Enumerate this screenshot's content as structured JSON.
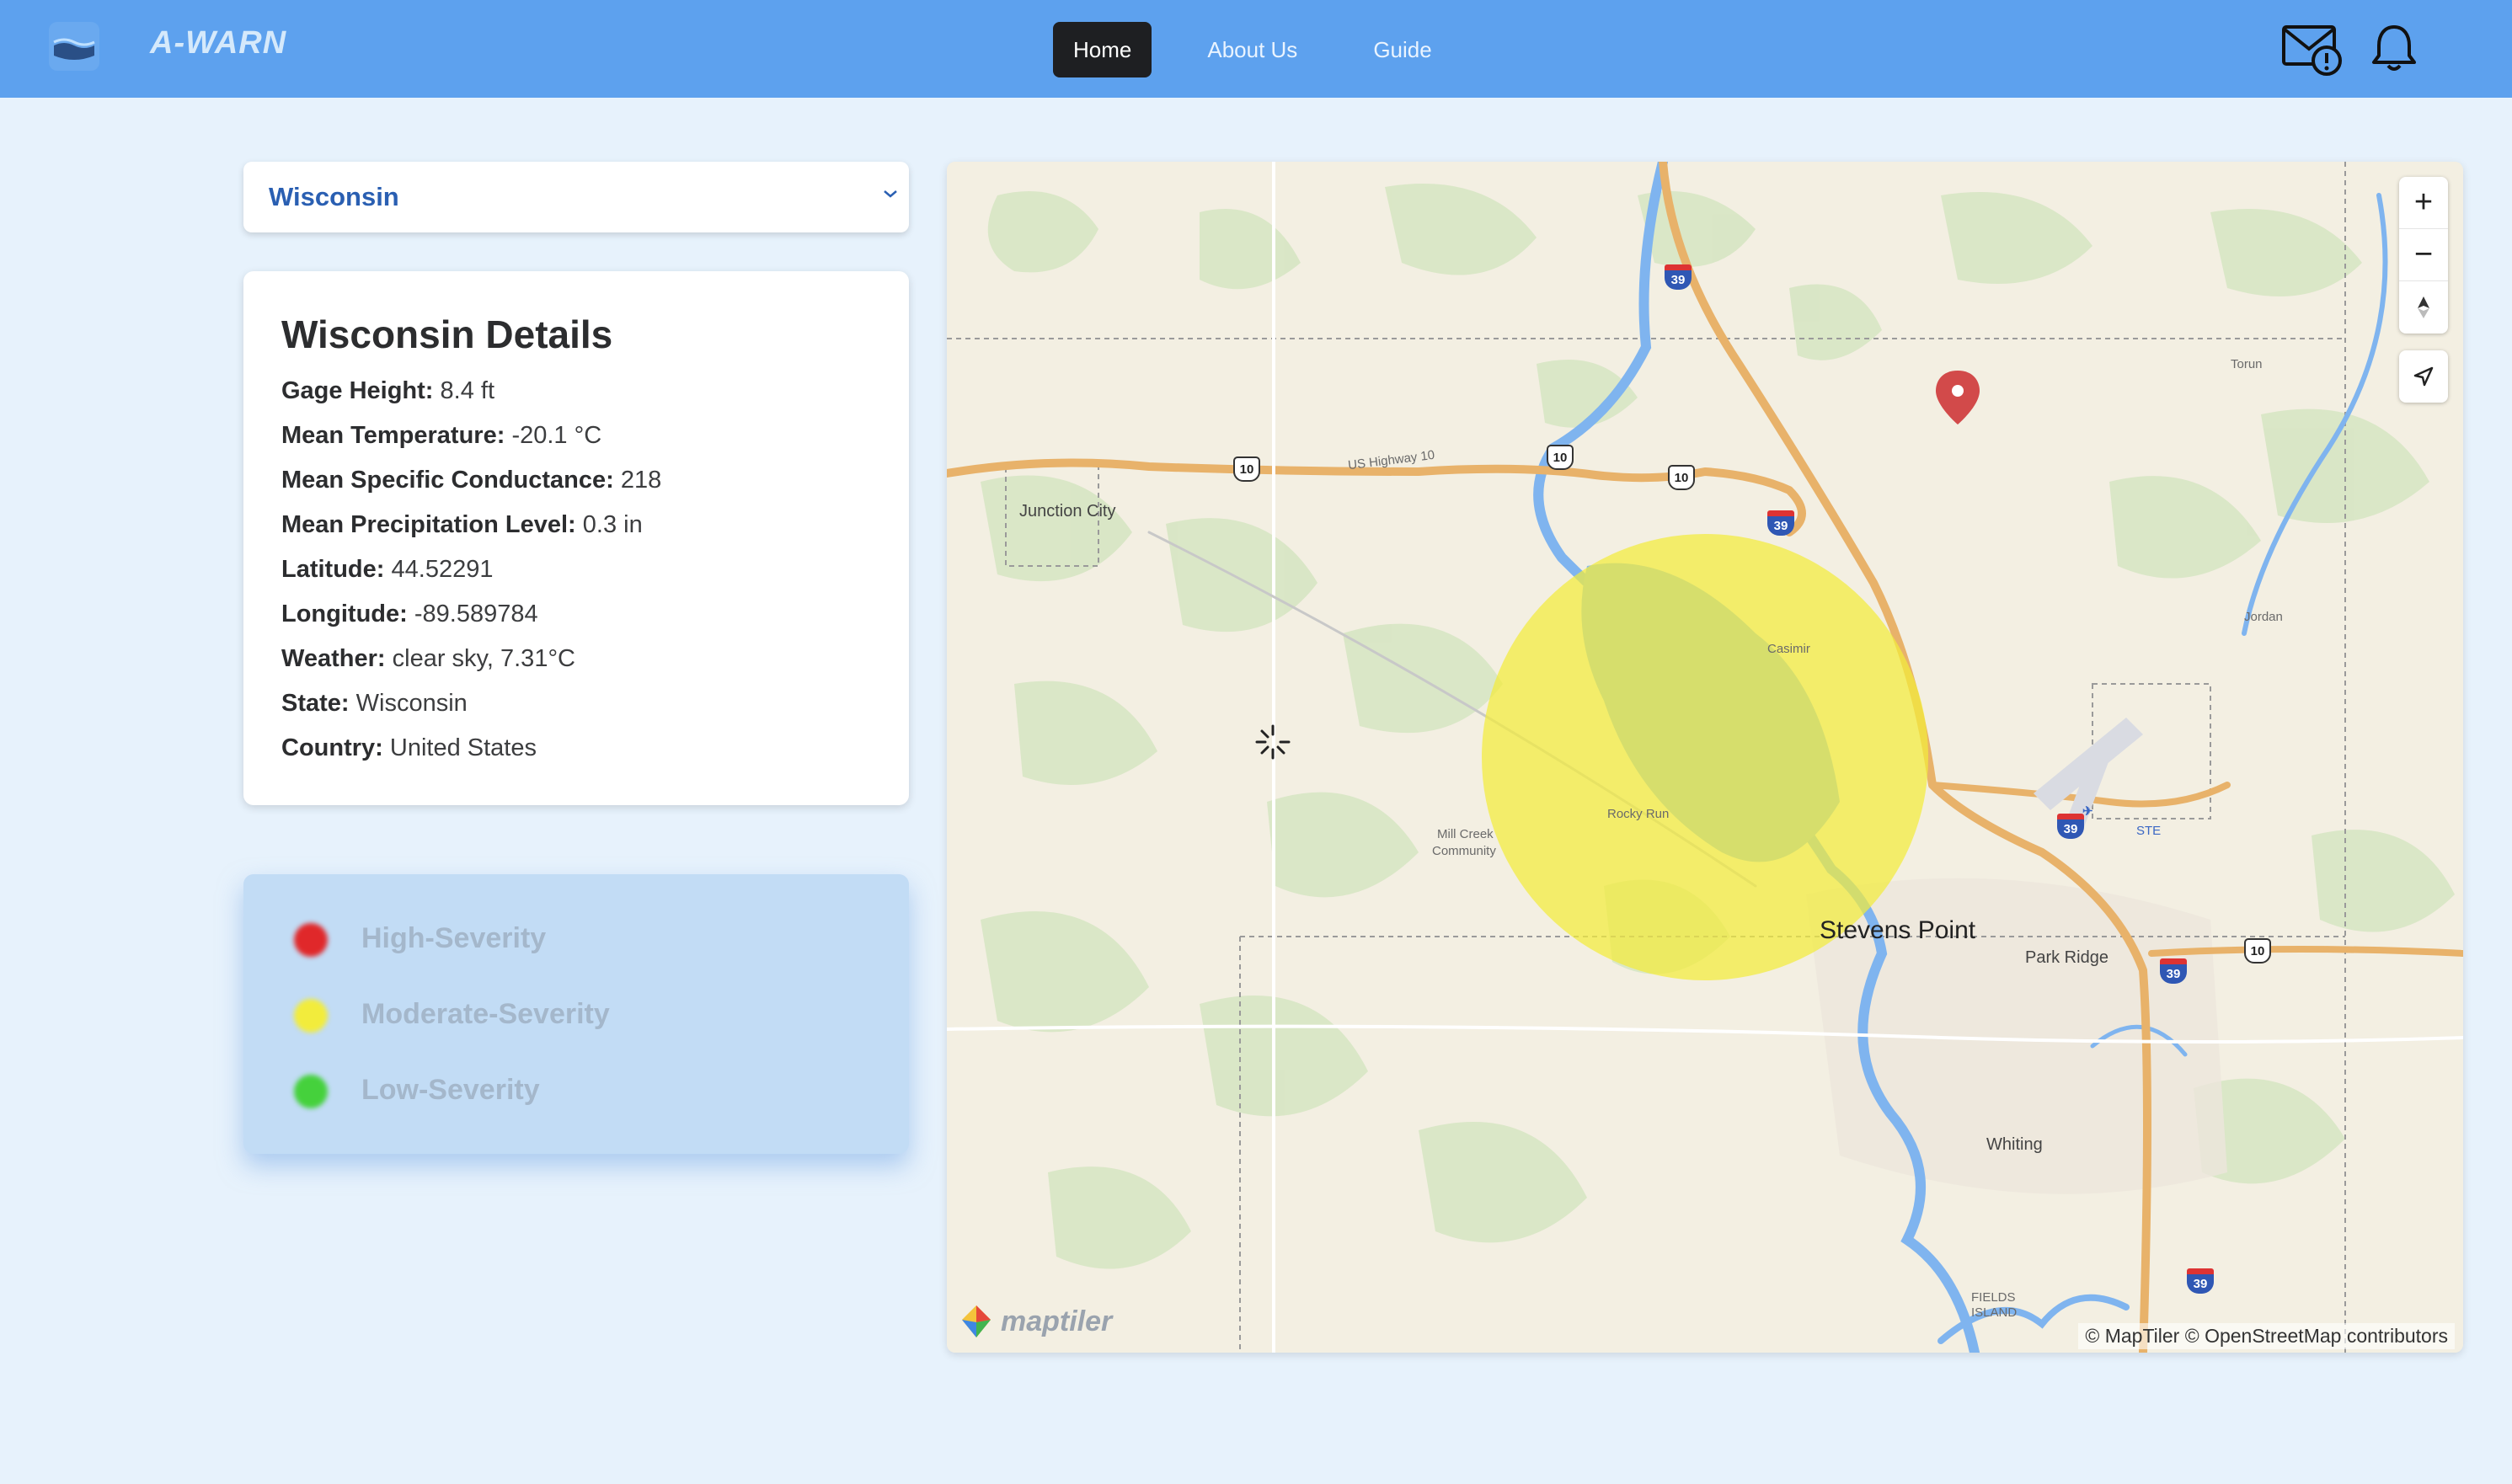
{
  "header": {
    "brand": "A-WARN",
    "nav": [
      "Home",
      "About Us",
      "Guide"
    ],
    "icons": [
      "mail-alert-icon",
      "bell-icon"
    ]
  },
  "state_select": {
    "value": "Wisconsin"
  },
  "details": {
    "title": "Wisconsin Details",
    "rows": [
      {
        "label": "Gage Height:",
        "value": "8.4 ft"
      },
      {
        "label": "Mean Temperature:",
        "value": "-20.1 °C"
      },
      {
        "label": "Mean Specific Conductance:",
        "value": "218"
      },
      {
        "label": "Mean Precipitation Level:",
        "value": "0.3 in"
      },
      {
        "label": "Latitude:",
        "value": "44.52291"
      },
      {
        "label": "Longitude:",
        "value": "-89.589784"
      },
      {
        "label": "Weather:",
        "value": "clear sky, 7.31°C"
      },
      {
        "label": "State:",
        "value": "Wisconsin"
      },
      {
        "label": "Country:",
        "value": "United States"
      }
    ]
  },
  "legend": {
    "items": [
      {
        "label": "High-Severity",
        "color": "#e0282a"
      },
      {
        "label": "Moderate-Severity",
        "color": "#f2ec3c"
      },
      {
        "label": "Low-Severity",
        "color": "#45d13c"
      }
    ]
  },
  "map": {
    "places": {
      "junction_city": "Junction City",
      "stevens_point": "Stevens Point",
      "park_ridge": "Park Ridge",
      "whiting": "Whiting",
      "torun": "Torun",
      "jordan": "Jordan",
      "casimir": "Casimir",
      "rocky_run": "Rocky Run",
      "mill_creek_1": "Mill Creek",
      "mill_creek_2": "Community",
      "fields_1": "FIELDS",
      "fields_2": "ISLAND",
      "ste": "STE",
      "highway": "US Highway 10"
    },
    "shields": {
      "us10": "10",
      "i39": "39"
    },
    "controls": {
      "zoom_in": "+",
      "zoom_out": "−"
    },
    "attribution": "© MapTiler © OpenStreetMap contributors",
    "logo_text": "maptiler",
    "severity_circle_color": "#f2ec3c"
  }
}
